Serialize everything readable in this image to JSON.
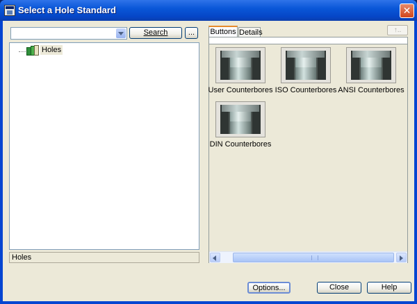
{
  "window": {
    "title": "Select a Hole Standard",
    "close_glyph": "✕"
  },
  "left": {
    "search_value": "",
    "search_label": "Search",
    "browse_label": "...",
    "tree": [
      {
        "label": "Holes",
        "icon": "books-icon"
      }
    ],
    "status": "Holes"
  },
  "right": {
    "tabs": [
      {
        "label": "Buttons",
        "active": true
      },
      {
        "label": "Details",
        "active": false
      }
    ],
    "up_label": "↑..",
    "items": [
      {
        "label": "User Counterbores",
        "icon": "counterbore-icon"
      },
      {
        "label": "ISO Counterbores",
        "icon": "counterbore-icon"
      },
      {
        "label": "ANSI Counterbores",
        "icon": "counterbore-icon"
      },
      {
        "label": "DIN Counterbores",
        "icon": "counterbore-icon"
      }
    ],
    "scroll_grip": "III"
  },
  "footer": {
    "options_label": "Options...",
    "close_label": "Close",
    "help_label": "Help"
  }
}
